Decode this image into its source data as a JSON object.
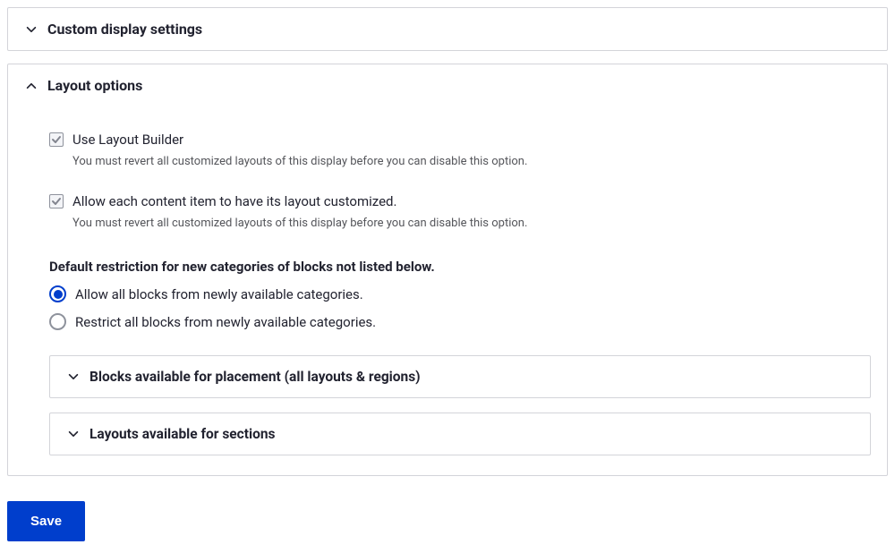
{
  "panels": {
    "custom_display": {
      "title": "Custom display settings"
    },
    "layout_options": {
      "title": "Layout options",
      "use_layout_builder": {
        "label": "Use Layout Builder",
        "help": "You must revert all customized layouts of this display before you can disable this option."
      },
      "allow_custom": {
        "label": "Allow each content item to have its layout customized.",
        "help": "You must revert all customized layouts of this display before you can disable this option."
      },
      "restriction_heading": "Default restriction for new categories of blocks not listed below.",
      "restriction_allow": "Allow all blocks from newly available categories.",
      "restriction_restrict": "Restrict all blocks from newly available categories.",
      "blocks_available": "Blocks available for placement (all layouts & regions)",
      "layouts_available": "Layouts available for sections"
    }
  },
  "actions": {
    "save": "Save"
  }
}
